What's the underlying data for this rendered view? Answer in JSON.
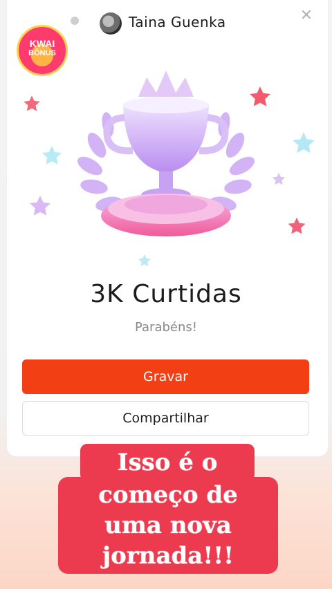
{
  "header": {
    "user_name": "Tai̇na Guenka",
    "close_icon": "close-icon"
  },
  "badge": {
    "line1": "KWAI",
    "line2": "BÔNUS"
  },
  "achievement": {
    "title": "3K Curtidas",
    "subtitle": "Parabéns!"
  },
  "actions": {
    "record_label": "Gravar",
    "share_label": "Compartilhar"
  },
  "caption": {
    "line1": "Isso é o",
    "line2": "começo de",
    "line3": "uma nova",
    "line4": "jornada!!!"
  },
  "colors": {
    "accent": "#f23f13",
    "caption_bg": "#ec3b4e",
    "trophy": "#c89cf0"
  }
}
